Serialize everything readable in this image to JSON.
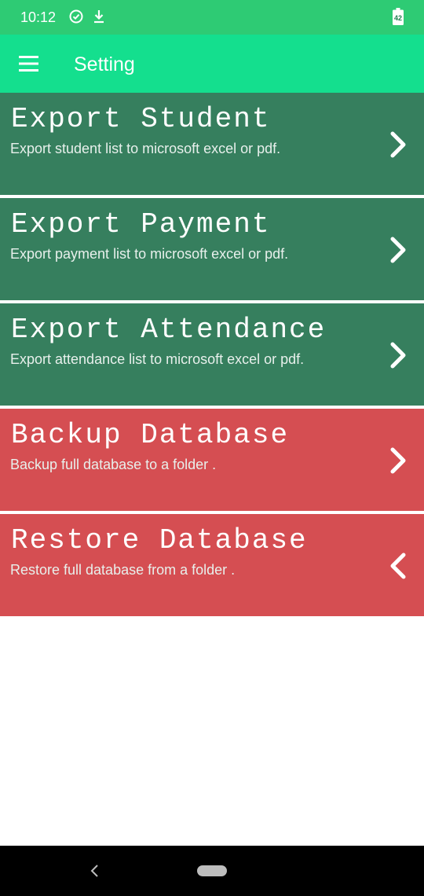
{
  "status_bar": {
    "time": "10:12",
    "icons": [
      "check-circle-icon",
      "download-icon"
    ],
    "battery_level": "42"
  },
  "app_bar": {
    "menu_icon": "menu-icon",
    "title": "Setting"
  },
  "cards": [
    {
      "title": "Export Student",
      "subtitle": "Export student list to microsoft excel or pdf.",
      "icon": "chevron-right-icon",
      "color": "#367f5e"
    },
    {
      "title": "Export Payment",
      "subtitle": "Export payment list to microsoft excel or pdf.",
      "icon": "chevron-right-icon",
      "color": "#367f5e"
    },
    {
      "title": "Export Attendance",
      "subtitle": "Export attendance list to microsoft excel or pdf.",
      "icon": "chevron-right-icon",
      "color": "#367f5e"
    },
    {
      "title": "Backup Database",
      "subtitle": "Backup full database to a folder .",
      "icon": "chevron-right-icon",
      "color": "#d54e52"
    },
    {
      "title": "Restore Database",
      "subtitle": "Restore full database from a folder .",
      "icon": "chevron-left-icon",
      "color": "#d54e52"
    }
  ],
  "colors": {
    "status_bar": "#2ecb74",
    "app_bar": "#14df8e",
    "export_card": "#367f5e",
    "database_card": "#d54e52"
  },
  "nav_bar": {
    "back_icon": "back-icon",
    "home_icon": "home-pill-icon"
  }
}
